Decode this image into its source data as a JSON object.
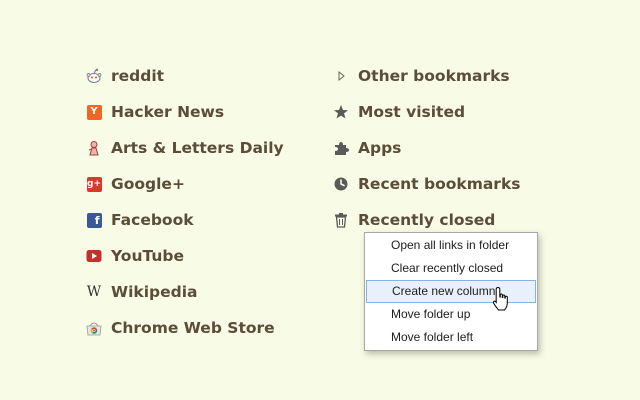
{
  "left_bookmarks": [
    {
      "label": "reddit",
      "icon": "reddit-icon"
    },
    {
      "label": "Hacker News",
      "icon": "hacker-news-icon"
    },
    {
      "label": "Arts & Letters Daily",
      "icon": "arts-letters-daily-icon"
    },
    {
      "label": "Google+",
      "icon": "google-plus-icon"
    },
    {
      "label": "Facebook",
      "icon": "facebook-icon"
    },
    {
      "label": "YouTube",
      "icon": "youtube-icon"
    },
    {
      "label": "Wikipedia",
      "icon": "wikipedia-icon"
    },
    {
      "label": "Chrome Web Store",
      "icon": "chrome-web-store-icon"
    }
  ],
  "right_folders": [
    {
      "label": "Other bookmarks",
      "icon": "triangle-right-icon"
    },
    {
      "label": "Most visited",
      "icon": "star-icon"
    },
    {
      "label": "Apps",
      "icon": "puzzle-icon"
    },
    {
      "label": "Recent bookmarks",
      "icon": "clock-icon"
    },
    {
      "label": "Recently closed",
      "icon": "trash-icon"
    }
  ],
  "context_menu": {
    "items": [
      {
        "label": "Open all links in folder"
      },
      {
        "label": "Clear recently closed"
      },
      {
        "label": "Create new column",
        "hovered": true
      },
      {
        "label": "Move folder up"
      },
      {
        "label": "Move folder left"
      }
    ]
  },
  "colors": {
    "background": "#f8fbe5",
    "text": "#5b4d38",
    "hacker_news": "#f26522",
    "google_plus": "#d63a2a",
    "facebook": "#3b5998",
    "youtube": "#c4302b",
    "menu_hover": "#e6f1fb"
  }
}
